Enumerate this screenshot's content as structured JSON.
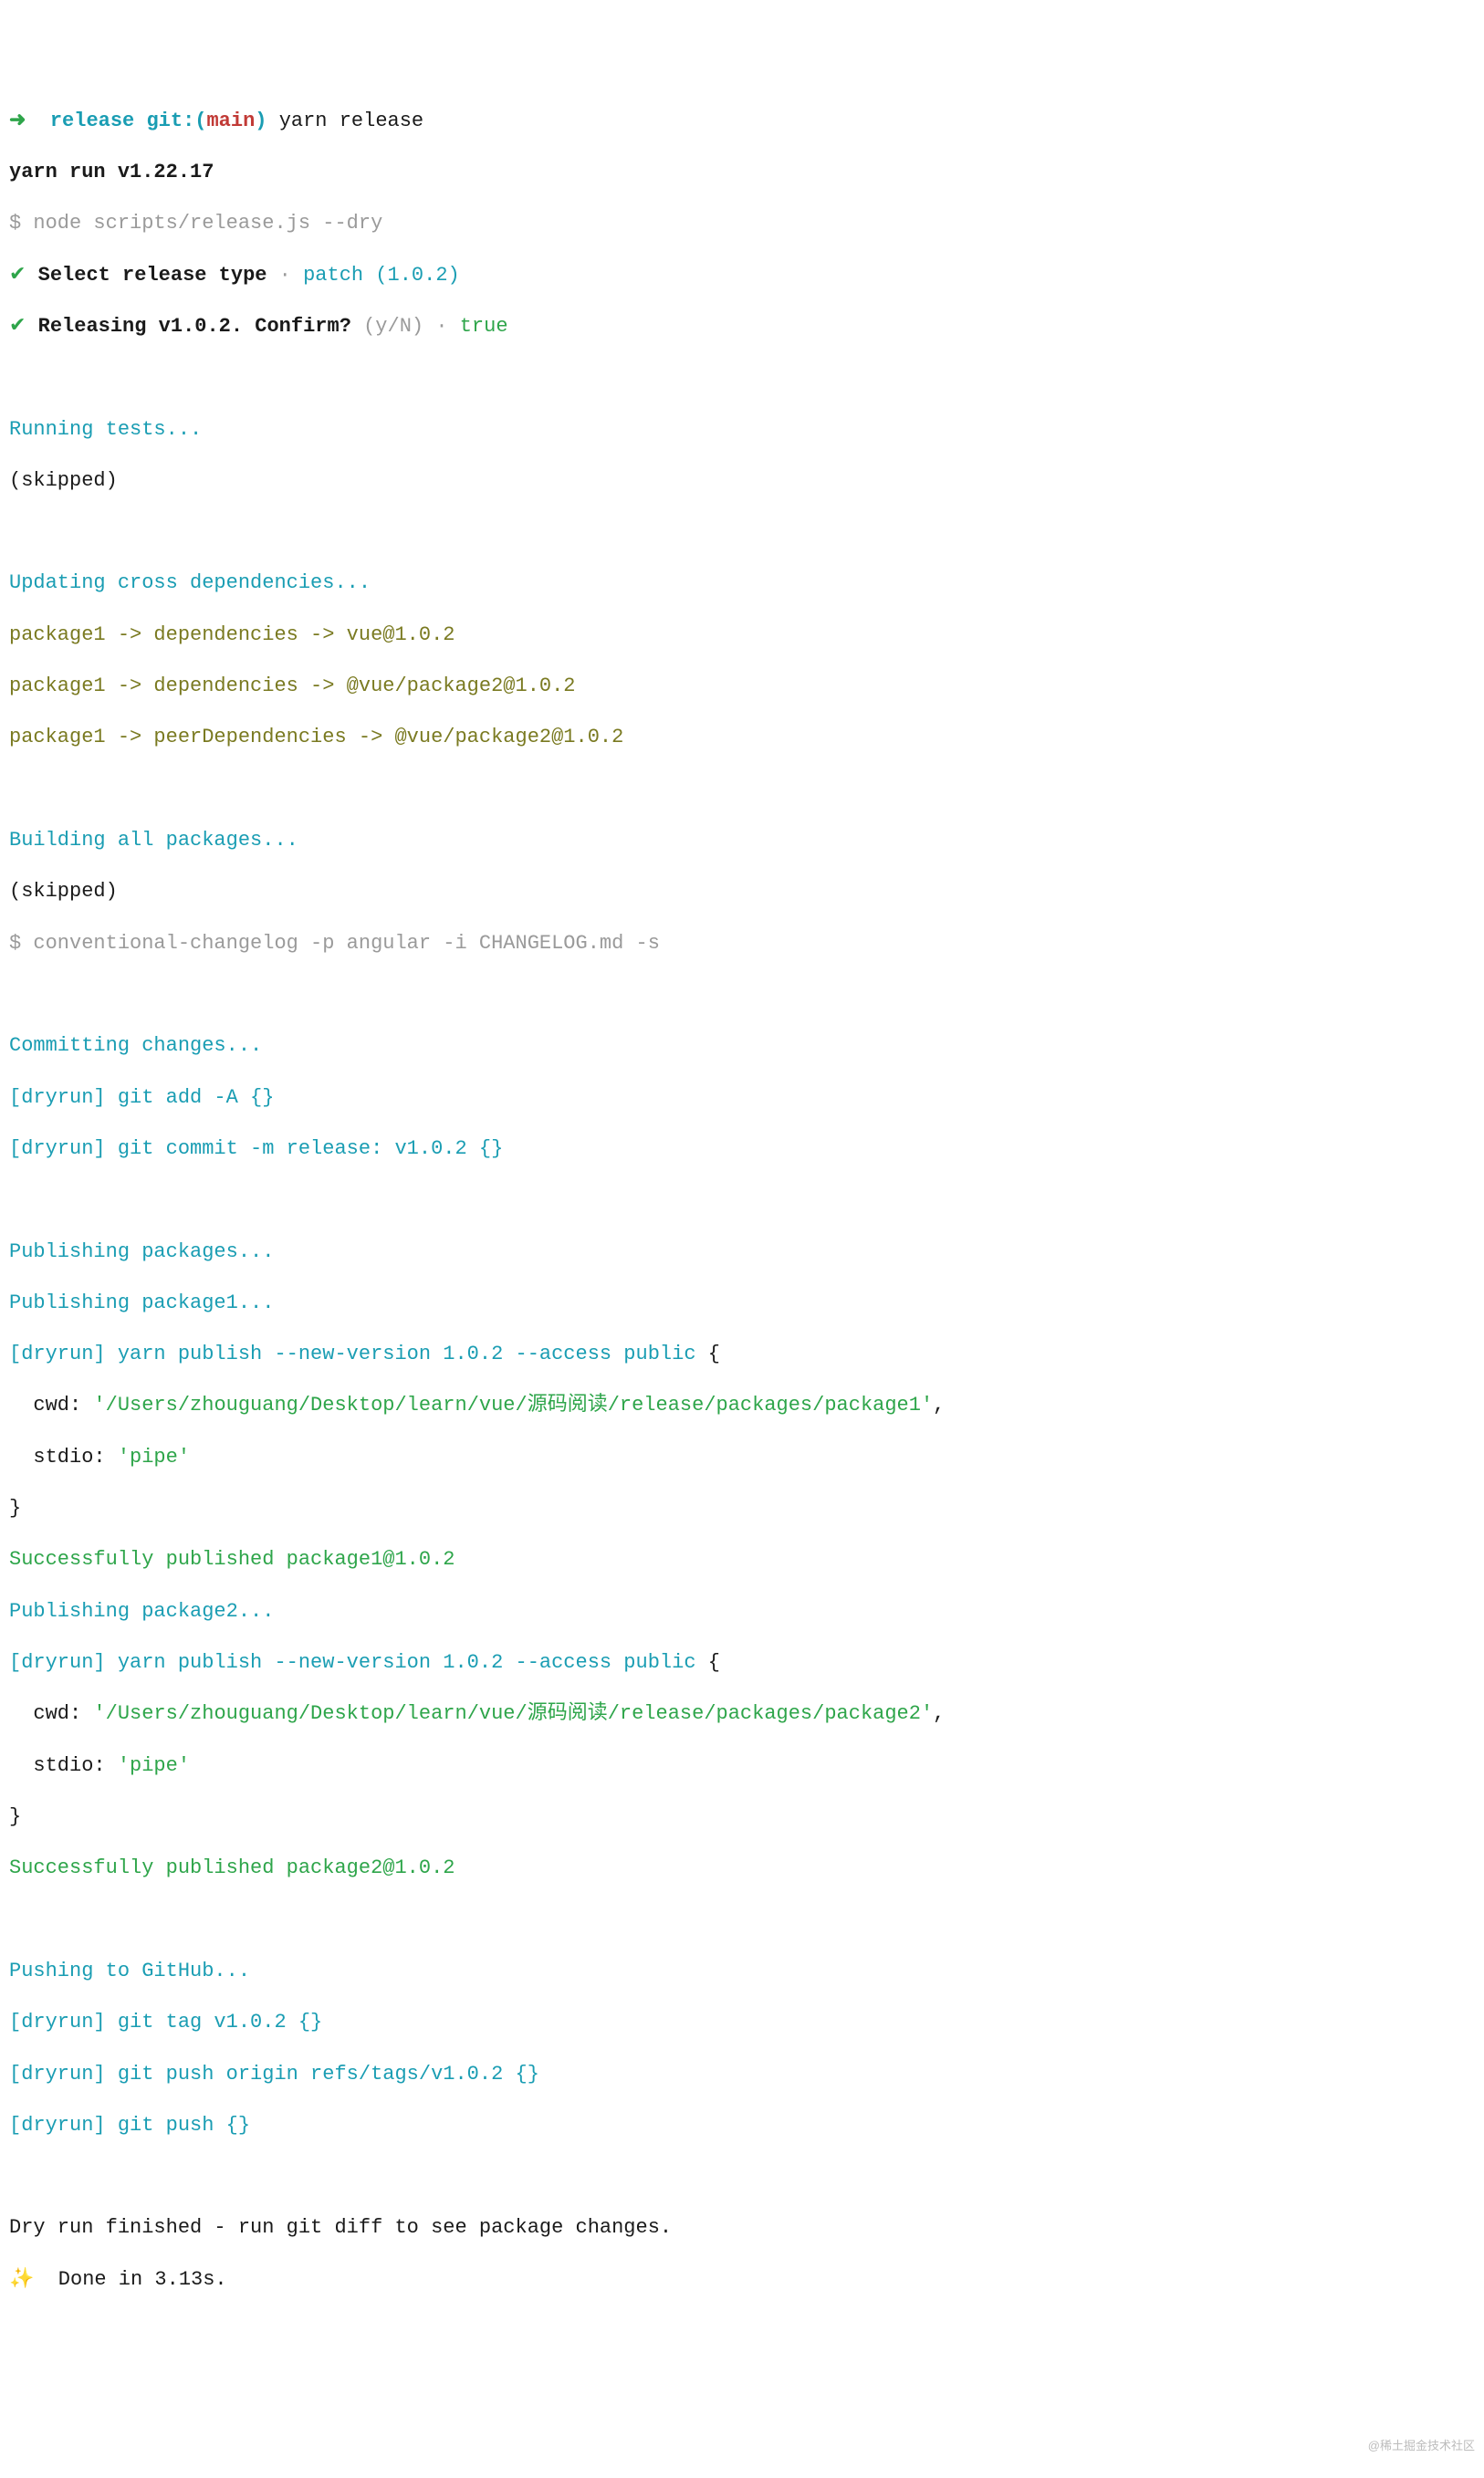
{
  "prompt": {
    "arrow": "➜  ",
    "cwd": "release",
    "git_open": " git:(",
    "branch": "main",
    "git_close": ")",
    "command": " yarn release"
  },
  "lines": {
    "yarn_run": "yarn run v1.22.17",
    "node_cmd": "$ node scripts/release.js --dry",
    "check1": "✔",
    "select_label": " Select release type",
    "dot1": " · ",
    "patch_choice": "patch (1.0.2)",
    "check2": "✔",
    "confirm_label": " Releasing v1.0.2. Confirm?",
    "yn": " (y/N)",
    "dot2": " · ",
    "true_val": "true",
    "running_tests": "Running tests...",
    "skipped1": "(skipped)",
    "updating_cross": "Updating cross dependencies...",
    "dep1": "package1 -> dependencies -> vue@1.0.2",
    "dep2": "package1 -> dependencies -> @vue/package2@1.0.2",
    "dep3": "package1 -> peerDependencies -> @vue/package2@1.0.2",
    "building": "Building all packages...",
    "skipped2": "(skipped)",
    "changelog": "$ conventional-changelog -p angular -i CHANGELOG.md -s",
    "committing": "Committing changes...",
    "git_add": "[dryrun] git add -A {}",
    "git_commit": "[dryrun] git commit -m release: v1.0.2 {}",
    "publishing": "Publishing packages...",
    "pub_pkg1": "Publishing package1...",
    "pub_cmd1_a": "[dryrun] yarn publish --new-version 1.0.2 --access public ",
    "brace_open": "{",
    "cwd_key1a": "  cwd: ",
    "cwd_val1": "'/Users/zhouguang/Desktop/learn/vue/源码阅读/release/packages/package1'",
    "comma": ",",
    "stdio_key": "  stdio: ",
    "stdio_val": "'pipe'",
    "brace_close": "}",
    "success1": "Successfully published package1@1.0.2",
    "pub_pkg2": "Publishing package2...",
    "pub_cmd2_a": "[dryrun] yarn publish --new-version 1.0.2 --access public ",
    "cwd_val2": "'/Users/zhouguang/Desktop/learn/vue/源码阅读/release/packages/package2'",
    "success2": "Successfully published package2@1.0.2",
    "pushing": "Pushing to GitHub...",
    "git_tag": "[dryrun] git tag v1.0.2 {}",
    "git_push_tags": "[dryrun] git push origin refs/tags/v1.0.2 {}",
    "git_push": "[dryrun] git push {}",
    "dry_finished": "Dry run finished - run git diff to see package changes.",
    "sparkle": "✨  ",
    "done": "Done in 3.13s."
  },
  "watermark": "@稀土掘金技术社区"
}
